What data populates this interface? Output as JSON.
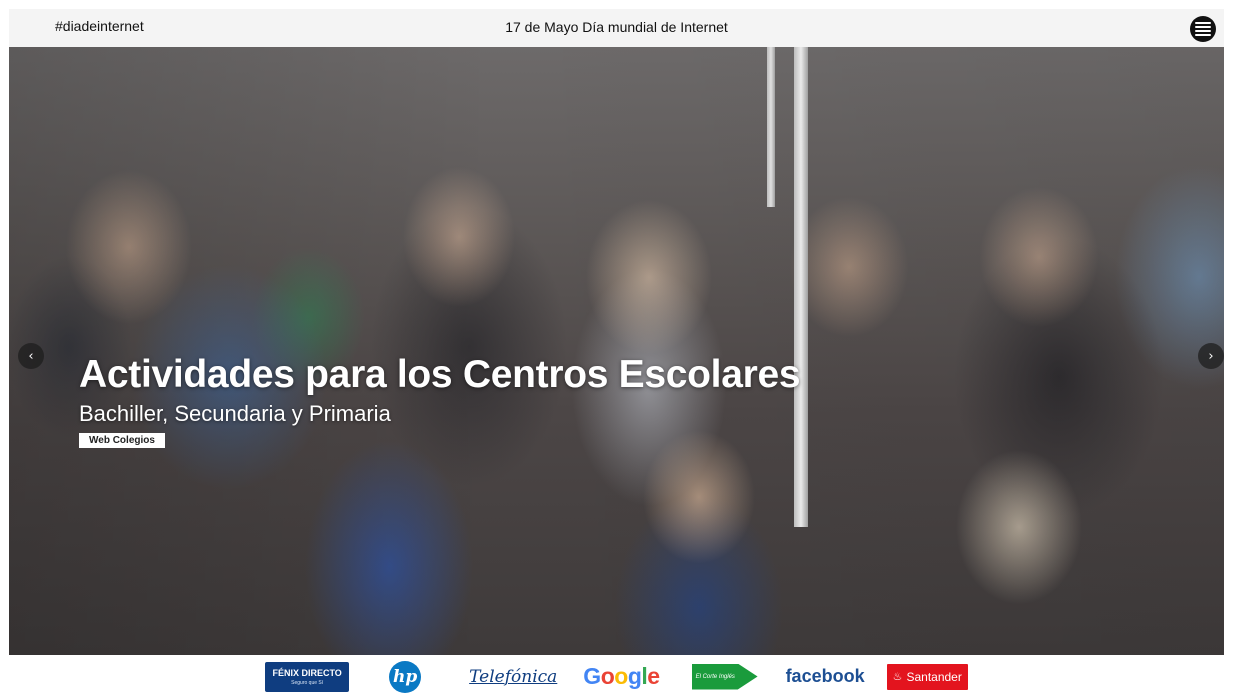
{
  "header": {
    "hashtag": "#diadeinternet",
    "title": "17 de Mayo Día mundial de Internet"
  },
  "hero": {
    "title": "Actividades para los Centros Escolares",
    "subtitle": "Bachiller, Secundaria y Primaria",
    "tag": "Web Colegios",
    "prev_arrow": "‹",
    "next_arrow": "›"
  },
  "sponsors": {
    "fenix_main": "FÉNIX DIRECTO",
    "fenix_sub": "Seguro que Sí",
    "hp": "hp",
    "telefonica": "Telefónica",
    "google": [
      "G",
      "o",
      "o",
      "g",
      "l",
      "e"
    ],
    "corte": "El Corte Inglés",
    "facebook": "facebook",
    "santander": "Santander"
  },
  "colors": {
    "topbar_bg": "#f4f4f4",
    "fenix_blue": "#0f3d80",
    "hp_blue": "#0a79c4",
    "corte_green": "#1a9b3c",
    "facebook_blue": "#1d4f93",
    "santander_red": "#e3141e"
  }
}
